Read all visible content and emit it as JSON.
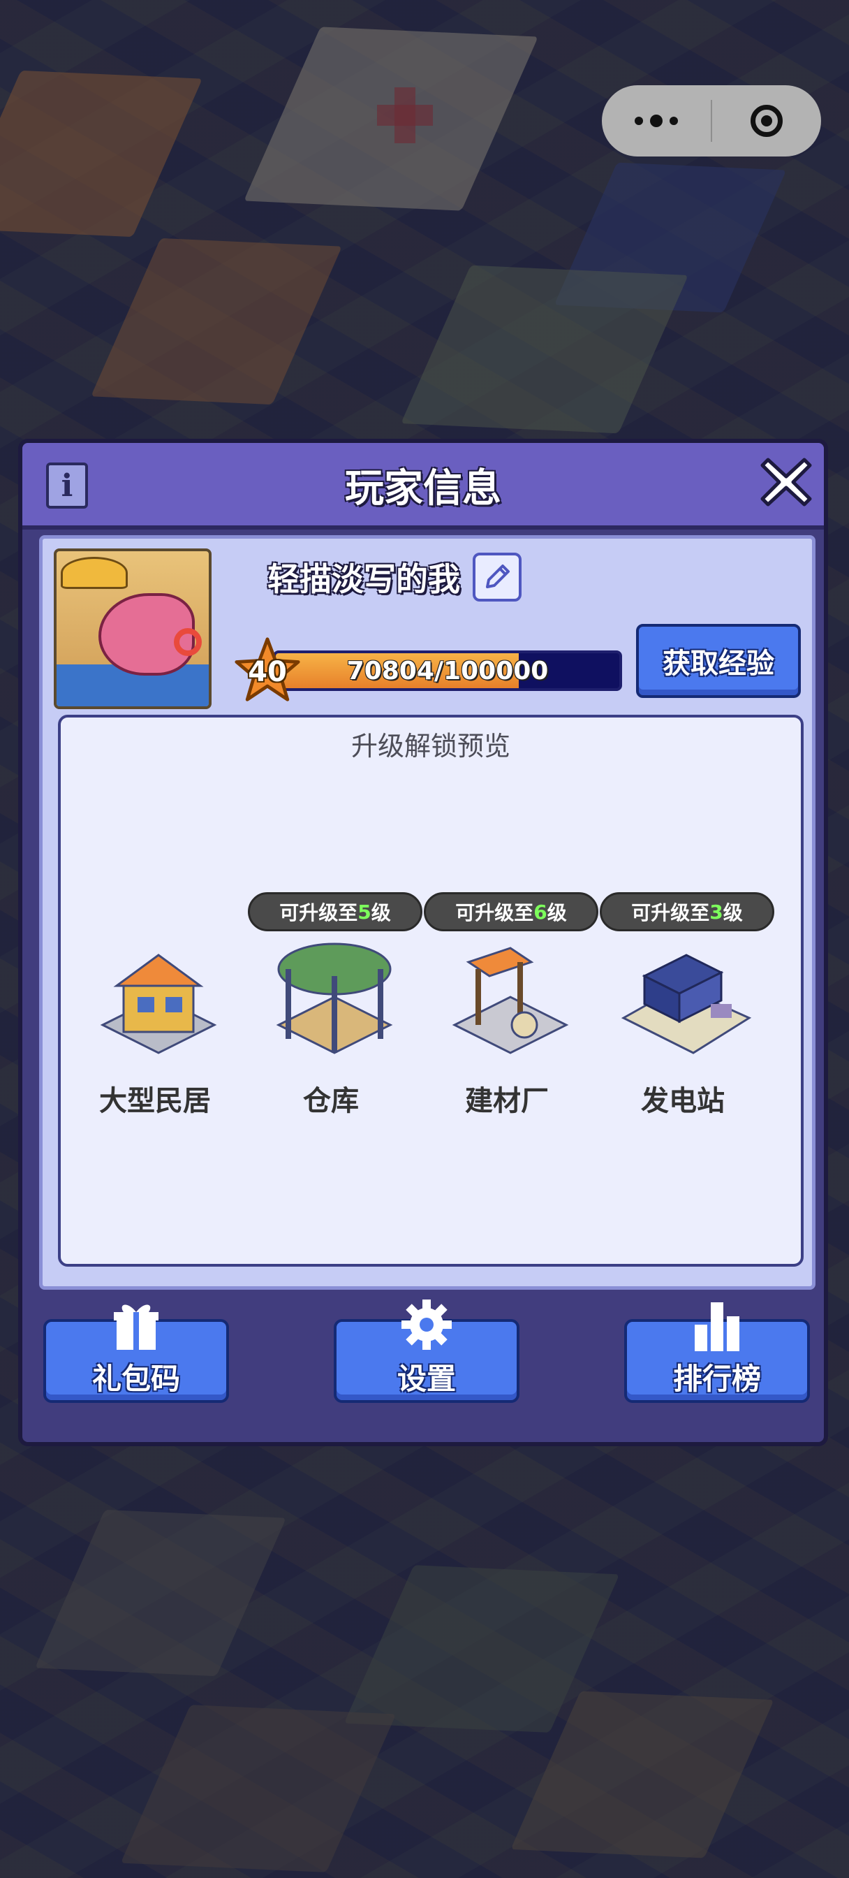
{
  "capsule": {
    "more_icon": "more-dots-icon",
    "close_icon": "target-circle-icon"
  },
  "dialog": {
    "title": "玩家信息",
    "info_icon": "info-icon",
    "close_icon": "close-x-icon",
    "player": {
      "name": "轻描淡写的我",
      "edit_icon": "pencil-icon",
      "level": "40",
      "xp_text": "70804/100000",
      "xp_fraction": 0.708,
      "get_xp_label": "获取经验"
    },
    "preview": {
      "title": "升级解锁预览",
      "buildings": [
        {
          "name": "大型民居",
          "badge": null
        },
        {
          "name": "仓库",
          "badge_prefix": "可升级至",
          "badge_level": "5",
          "badge_suffix": "级"
        },
        {
          "name": "建材厂",
          "badge_prefix": "可升级至",
          "badge_level": "6",
          "badge_suffix": "级"
        },
        {
          "name": "发电站",
          "badge_prefix": "可升级至",
          "badge_level": "3",
          "badge_suffix": "级"
        }
      ]
    },
    "buttons": {
      "gift_code": "礼包码",
      "settings": "设置",
      "ranking": "排行榜"
    }
  },
  "colors": {
    "accent": "#4b79ee",
    "header": "#6a5fc0",
    "panel": "#c6ccf5",
    "badge_number": "#7dff5c"
  }
}
